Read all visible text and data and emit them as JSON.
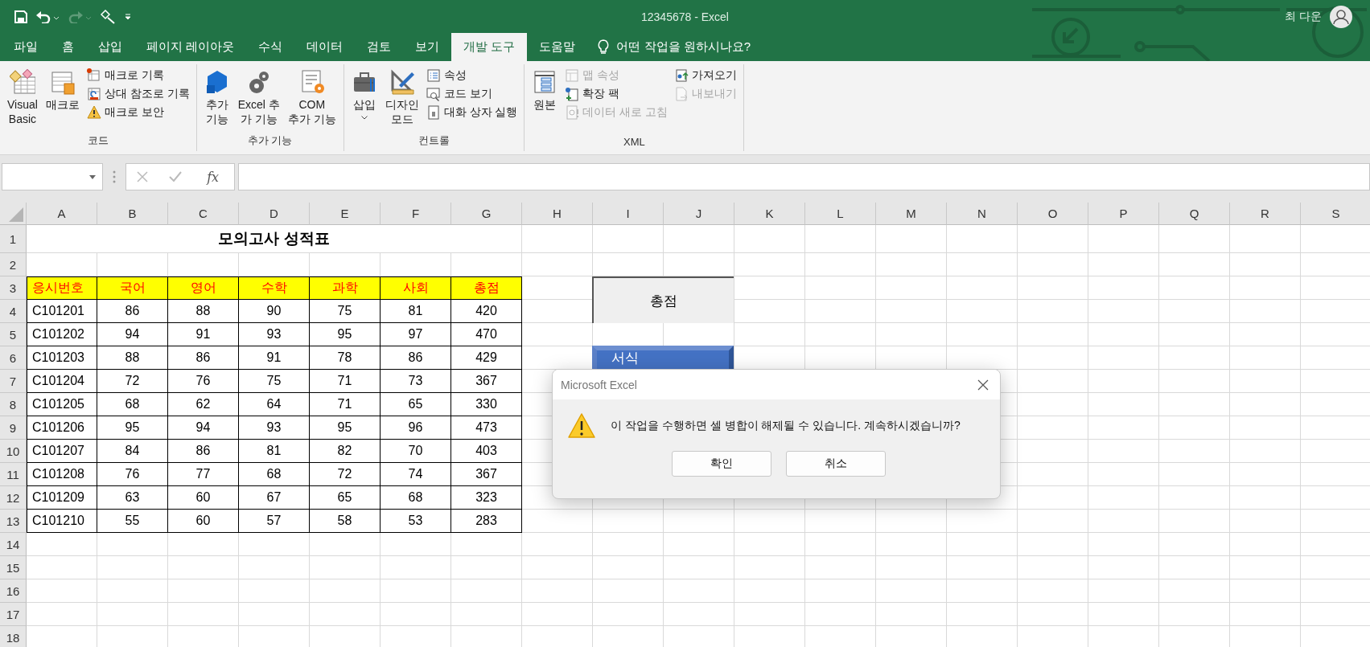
{
  "window": {
    "title": "12345678  -  Excel",
    "user": "최 다운"
  },
  "tabs": [
    {
      "label": "파일",
      "selected": false
    },
    {
      "label": "홈",
      "selected": false
    },
    {
      "label": "삽입",
      "selected": false
    },
    {
      "label": "페이지 레이아웃",
      "selected": false
    },
    {
      "label": "수식",
      "selected": false
    },
    {
      "label": "데이터",
      "selected": false
    },
    {
      "label": "검토",
      "selected": false
    },
    {
      "label": "보기",
      "selected": false
    },
    {
      "label": "개발 도구",
      "selected": true
    },
    {
      "label": "도움말",
      "selected": false
    }
  ],
  "tell_me": "어떤 작업을 원하시나요?",
  "ribbon": [
    {
      "label": "코드",
      "columns": [
        {
          "kind": "large",
          "label": "Visual\nBasic"
        },
        {
          "kind": "large",
          "label": "매크로"
        },
        {
          "kind": "stack",
          "items": [
            {
              "label": "매크로 기록",
              "disabled": false
            },
            {
              "label": "상대 참조로 기록",
              "disabled": false
            },
            {
              "label": "매크로 보안",
              "disabled": false
            }
          ]
        }
      ]
    },
    {
      "label": "추가 기능",
      "columns": [
        {
          "kind": "large",
          "label": "추가\n기능"
        },
        {
          "kind": "large",
          "label": "Excel 추\n가 기능"
        },
        {
          "kind": "large",
          "label": "COM\n추가 기능"
        }
      ]
    },
    {
      "label": "컨트롤",
      "columns": [
        {
          "kind": "large",
          "label": "삽입",
          "dropdown": true
        },
        {
          "kind": "large",
          "label": "디자인\n모드"
        },
        {
          "kind": "stack",
          "items": [
            {
              "label": "속성",
              "disabled": false
            },
            {
              "label": "코드 보기",
              "disabled": false
            },
            {
              "label": "대화 상자 실행",
              "disabled": false
            }
          ]
        }
      ]
    },
    {
      "label": "XML",
      "columns": [
        {
          "kind": "large",
          "label": "원본"
        },
        {
          "kind": "stack",
          "items": [
            {
              "label": "맵 속성",
              "disabled": true
            },
            {
              "label": "확장 팩",
              "disabled": false
            },
            {
              "label": "데이터 새로 고침",
              "disabled": true
            }
          ]
        },
        {
          "kind": "stack",
          "items": [
            {
              "label": "가져오기",
              "disabled": false
            },
            {
              "label": "내보내기",
              "disabled": true
            }
          ]
        }
      ]
    }
  ],
  "formula_bar": {
    "function_button": "fx"
  },
  "sheet": {
    "columns": [
      "A",
      "B",
      "C",
      "D",
      "E",
      "F",
      "G",
      "H",
      "I",
      "J",
      "K",
      "L",
      "M",
      "N",
      "O",
      "P",
      "Q",
      "R",
      "S"
    ],
    "row_numbers": [
      "1",
      "2",
      "3",
      "4",
      "5",
      "6",
      "7",
      "8",
      "9",
      "10",
      "11",
      "12",
      "13",
      "14",
      "15",
      "16",
      "17",
      "18"
    ],
    "title": "모의고사 성적표",
    "header": [
      "응시번호",
      "국어",
      "영어",
      "수학",
      "과학",
      "사회",
      "총점"
    ],
    "rows": [
      [
        "C101201",
        "86",
        "88",
        "90",
        "75",
        "81",
        "420"
      ],
      [
        "C101202",
        "94",
        "91",
        "93",
        "95",
        "97",
        "470"
      ],
      [
        "C101203",
        "88",
        "86",
        "91",
        "78",
        "86",
        "429"
      ],
      [
        "C101204",
        "72",
        "76",
        "75",
        "71",
        "73",
        "367"
      ],
      [
        "C101205",
        "68",
        "62",
        "64",
        "71",
        "65",
        "330"
      ],
      [
        "C101206",
        "95",
        "94",
        "93",
        "95",
        "96",
        "473"
      ],
      [
        "C101207",
        "84",
        "86",
        "81",
        "82",
        "70",
        "403"
      ],
      [
        "C101208",
        "76",
        "77",
        "68",
        "72",
        "74",
        "367"
      ],
      [
        "C101209",
        "63",
        "60",
        "67",
        "65",
        "68",
        "323"
      ],
      [
        "C101210",
        "55",
        "60",
        "57",
        "58",
        "53",
        "283"
      ]
    ]
  },
  "shapes": [
    {
      "kind": "grey",
      "label": "총점"
    },
    {
      "kind": "blue",
      "label": "서식"
    }
  ],
  "dialog": {
    "title": "Microsoft Excel",
    "message": "이 작업을 수행하면 셀 병합이 해제될 수 있습니다. 계속하시겠습니까?",
    "buttons": [
      "확인",
      "취소"
    ]
  }
}
